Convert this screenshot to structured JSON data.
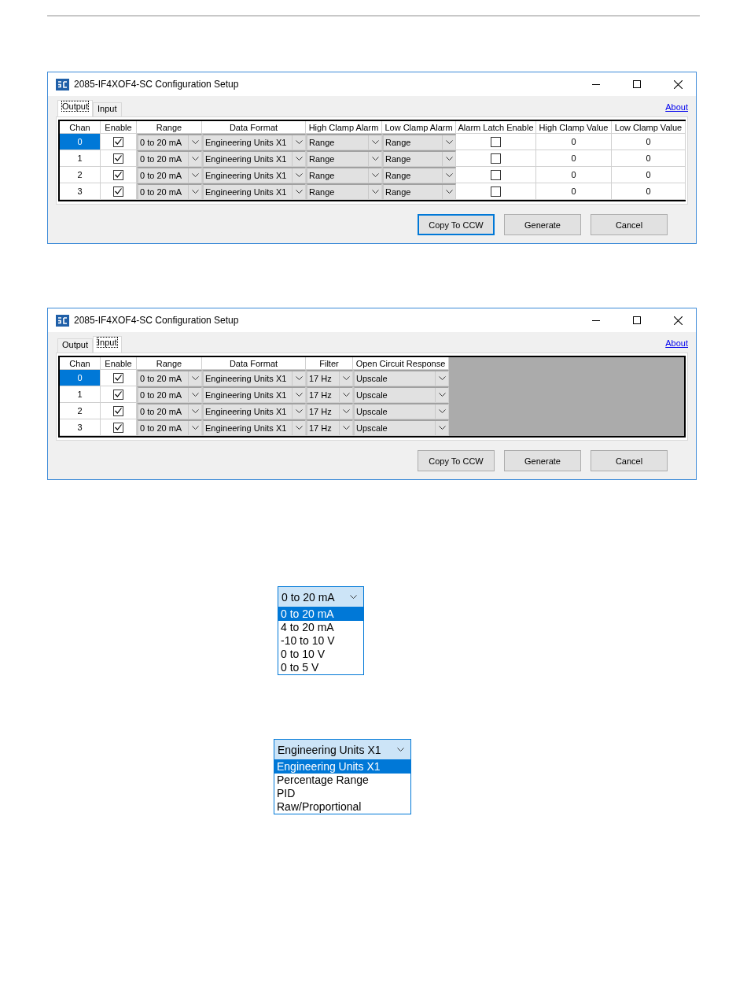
{
  "windows": [
    {
      "title": "2085-IF4XOF4-SC Configuration Setup",
      "tabs": [
        {
          "label": "Output",
          "selected": true
        },
        {
          "label": "Input",
          "selected": false
        }
      ],
      "about": "About",
      "columns": [
        "Chan",
        "Enable",
        "Range",
        "Data Format",
        "High Clamp Alarm",
        "Low Clamp Alarm",
        "Alarm Latch Enable",
        "High Clamp Value",
        "Low Clamp Value"
      ],
      "rows": [
        {
          "selected": true,
          "cells": [
            {
              "kind": "text",
              "value": "0"
            },
            {
              "kind": "check",
              "checked": true
            },
            {
              "kind": "combo",
              "value": "0 to 20 mA"
            },
            {
              "kind": "combo",
              "value": "Engineering Units X1"
            },
            {
              "kind": "combo",
              "value": "Range"
            },
            {
              "kind": "combo",
              "value": "Range"
            },
            {
              "kind": "check",
              "checked": false
            },
            {
              "kind": "text",
              "value": "0"
            },
            {
              "kind": "text",
              "value": "0"
            }
          ]
        },
        {
          "selected": false,
          "cells": [
            {
              "kind": "text",
              "value": "1"
            },
            {
              "kind": "check",
              "checked": true
            },
            {
              "kind": "combo",
              "value": "0 to 20 mA"
            },
            {
              "kind": "combo",
              "value": "Engineering Units X1"
            },
            {
              "kind": "combo",
              "value": "Range"
            },
            {
              "kind": "combo",
              "value": "Range"
            },
            {
              "kind": "check",
              "checked": false
            },
            {
              "kind": "text",
              "value": "0"
            },
            {
              "kind": "text",
              "value": "0"
            }
          ]
        },
        {
          "selected": false,
          "cells": [
            {
              "kind": "text",
              "value": "2"
            },
            {
              "kind": "check",
              "checked": true
            },
            {
              "kind": "combo",
              "value": "0 to 20 mA"
            },
            {
              "kind": "combo",
              "value": "Engineering Units X1"
            },
            {
              "kind": "combo",
              "value": "Range"
            },
            {
              "kind": "combo",
              "value": "Range"
            },
            {
              "kind": "check",
              "checked": false
            },
            {
              "kind": "text",
              "value": "0"
            },
            {
              "kind": "text",
              "value": "0"
            }
          ]
        },
        {
          "selected": false,
          "cells": [
            {
              "kind": "text",
              "value": "3"
            },
            {
              "kind": "check",
              "checked": true
            },
            {
              "kind": "combo",
              "value": "0 to 20 mA"
            },
            {
              "kind": "combo",
              "value": "Engineering Units X1"
            },
            {
              "kind": "combo",
              "value": "Range"
            },
            {
              "kind": "combo",
              "value": "Range"
            },
            {
              "kind": "check",
              "checked": false
            },
            {
              "kind": "text",
              "value": "0"
            },
            {
              "kind": "text",
              "value": "0"
            }
          ]
        }
      ],
      "buttons": [
        {
          "label": "Copy To CCW",
          "focused": true
        },
        {
          "label": "Generate",
          "focused": false
        },
        {
          "label": "Cancel",
          "focused": false
        }
      ]
    },
    {
      "title": "2085-IF4XOF4-SC Configuration Setup",
      "tabs": [
        {
          "label": "Output",
          "selected": false
        },
        {
          "label": "Input",
          "selected": true
        }
      ],
      "about": "About",
      "columns": [
        "Chan",
        "Enable",
        "Range",
        "Data Format",
        "Filter",
        "Open Circuit Response"
      ],
      "rows": [
        {
          "selected": true,
          "cells": [
            {
              "kind": "text",
              "value": "0"
            },
            {
              "kind": "check",
              "checked": true
            },
            {
              "kind": "combo",
              "value": "0 to 20 mA"
            },
            {
              "kind": "combo",
              "value": "Engineering Units X1"
            },
            {
              "kind": "combo",
              "value": "17 Hz"
            },
            {
              "kind": "combo",
              "value": "Upscale"
            }
          ]
        },
        {
          "selected": false,
          "cells": [
            {
              "kind": "text",
              "value": "1"
            },
            {
              "kind": "check",
              "checked": true
            },
            {
              "kind": "combo",
              "value": "0 to 20 mA"
            },
            {
              "kind": "combo",
              "value": "Engineering Units X1"
            },
            {
              "kind": "combo",
              "value": "17 Hz"
            },
            {
              "kind": "combo",
              "value": "Upscale"
            }
          ]
        },
        {
          "selected": false,
          "cells": [
            {
              "kind": "text",
              "value": "2"
            },
            {
              "kind": "check",
              "checked": true
            },
            {
              "kind": "combo",
              "value": "0 to 20 mA"
            },
            {
              "kind": "combo",
              "value": "Engineering Units X1"
            },
            {
              "kind": "combo",
              "value": "17 Hz"
            },
            {
              "kind": "combo",
              "value": "Upscale"
            }
          ]
        },
        {
          "selected": false,
          "cells": [
            {
              "kind": "text",
              "value": "3"
            },
            {
              "kind": "check",
              "checked": true
            },
            {
              "kind": "combo",
              "value": "0 to 20 mA"
            },
            {
              "kind": "combo",
              "value": "Engineering Units X1"
            },
            {
              "kind": "combo",
              "value": "17 Hz"
            },
            {
              "kind": "combo",
              "value": "Upscale"
            }
          ]
        }
      ],
      "buttons": [
        {
          "label": "Copy To CCW",
          "focused": false
        },
        {
          "label": "Generate",
          "focused": false
        },
        {
          "label": "Cancel",
          "focused": false
        }
      ]
    }
  ],
  "dropdowns": [
    {
      "value": "0 to 20 mA",
      "options": [
        {
          "label": "0 to 20 mA",
          "selected": true
        },
        {
          "label": "4 to 20 mA",
          "selected": false
        },
        {
          "label": "-10 to 10 V",
          "selected": false
        },
        {
          "label": "0 to 10 V",
          "selected": false
        },
        {
          "label": "0 to 5 V",
          "selected": false
        }
      ]
    },
    {
      "value": "Engineering Units X1",
      "options": [
        {
          "label": "Engineering Units X1",
          "selected": true
        },
        {
          "label": "Percentage Range",
          "selected": false
        },
        {
          "label": "PID",
          "selected": false
        },
        {
          "label": "Raw/Proportional",
          "selected": false
        }
      ]
    }
  ]
}
